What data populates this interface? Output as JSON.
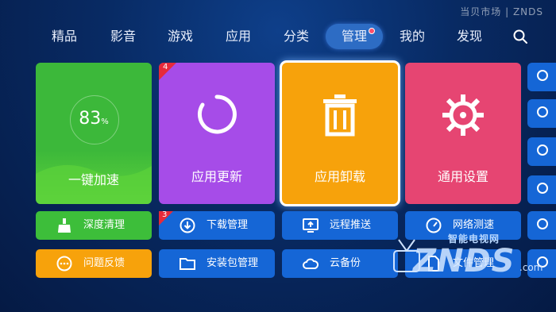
{
  "brand": "当贝市场 | ZNDS",
  "nav": {
    "items": [
      {
        "label": "精品"
      },
      {
        "label": "影音"
      },
      {
        "label": "游戏"
      },
      {
        "label": "应用"
      },
      {
        "label": "分类"
      },
      {
        "label": "管理"
      },
      {
        "label": "我的"
      },
      {
        "label": "发现"
      }
    ],
    "active": "管理"
  },
  "tiles": {
    "speedup": {
      "label": "一键加速",
      "value": "83",
      "unit": "%",
      "color": "#3dbe3a"
    },
    "update": {
      "label": "应用更新",
      "badge": "4",
      "color": "#a64ce8"
    },
    "uninstall": {
      "label": "应用卸载",
      "color": "#f7a20b"
    },
    "settings": {
      "label": "通用设置",
      "color": "#e64572"
    }
  },
  "small_buttons": {
    "deep_clean": {
      "label": "深度清理",
      "color": "#3dbe3a"
    },
    "download": {
      "label": "下载管理",
      "badge": "3"
    },
    "remote_push": {
      "label": "远程推送"
    },
    "speed_test": {
      "label": "网络测速"
    },
    "feedback": {
      "label": "问题反馈",
      "color": "#f7a20b"
    },
    "apk_manager": {
      "label": "安装包管理"
    },
    "cloud_backup": {
      "label": "云备份"
    },
    "file_manager": {
      "label": "文件管理"
    }
  },
  "watermark": {
    "cn": "智能电视网",
    "main": "ZNDS",
    "suffix": ".com"
  }
}
